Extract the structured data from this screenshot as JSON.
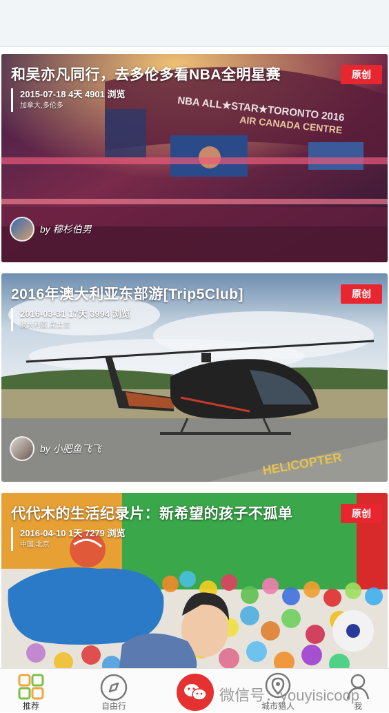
{
  "feed": {
    "cards": [
      {
        "title": "和吴亦凡同行，去多伦多看NBA全明星赛",
        "meta": "2015-07-18  4天  4901 浏览",
        "location": "加拿大,多伦多",
        "badge": "原创",
        "author": "by 穆杉伯男",
        "banner_text": "NBA ALL★STAR★TORONTO 2016",
        "arena_text": "AIR CANADA CENTRE"
      },
      {
        "title": "2016年澳大利亚东部游[Trip5Club]",
        "meta": "2016-03-31  17天  3994 浏览",
        "location": "澳大利亚,昆士兰",
        "badge": "原创",
        "author": "by 小肥鱼飞飞"
      },
      {
        "title": "代代木的生活纪录片：新希望的孩子不孤单",
        "meta": "2016-04-10  1天  7279 浏览",
        "location": "中国,北京",
        "badge": "原创",
        "author": ""
      }
    ]
  },
  "tabbar": {
    "tabs": [
      {
        "label": "推荐",
        "icon": "grid-icon"
      },
      {
        "label": "自由行",
        "icon": "compass-icon"
      },
      {
        "label": "",
        "icon": "chat-icon"
      },
      {
        "label": "城市猎人",
        "icon": "location-pin-icon"
      },
      {
        "label": "我",
        "icon": "profile-icon"
      }
    ]
  },
  "watermark": "微信号：youyisicoop",
  "colors": {
    "accent": "#e5312f",
    "badge": "#e8262f",
    "grid_icon": [
      "#f2a53c",
      "#7bc043",
      "#7bc043",
      "#f2a53c"
    ]
  }
}
